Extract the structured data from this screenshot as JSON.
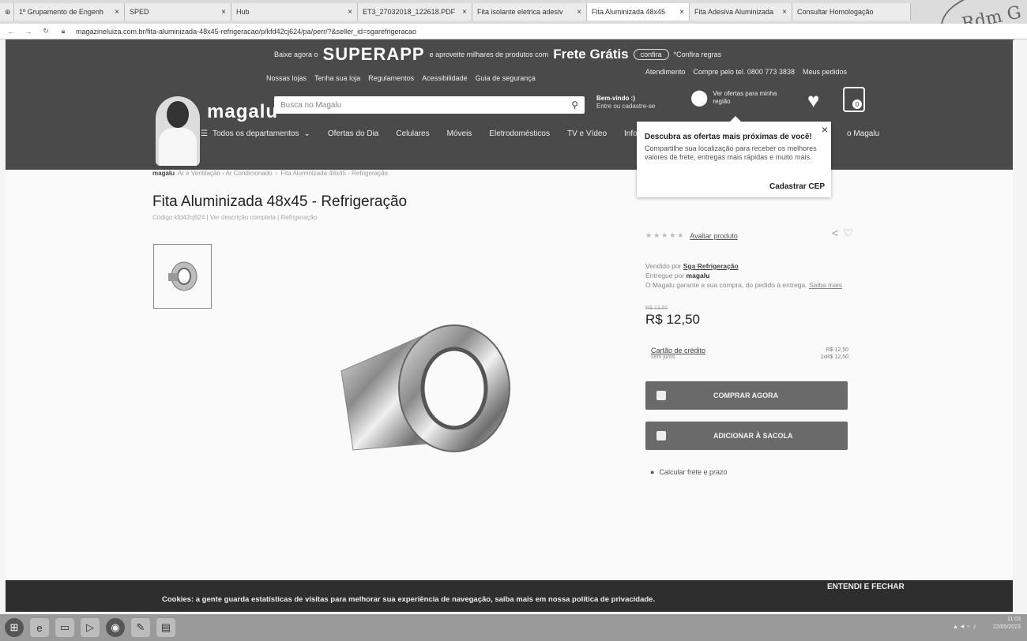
{
  "browser": {
    "tabs": [
      {
        "label": "1º Grupamento de Engenh"
      },
      {
        "label": "SPED"
      },
      {
        "label": "Hub"
      },
      {
        "label": "ET3_27032018_122618.PDF"
      },
      {
        "label": "Fita isolante eletrica adesiv"
      },
      {
        "label": "Fita Aluminizada 48x45"
      },
      {
        "label": "Fita Adesiva Aluminizada"
      },
      {
        "label": "Consultar Homologação"
      }
    ],
    "url": "magazineluiza.com.br/fita-aluminizada-48x45-refrigeracao/p/kfd42cj624/pa/perr/?&seller_id=sgarefrigeracao"
  },
  "stamp": {
    "text": "Rdm G"
  },
  "header": {
    "promo": {
      "download": "Baixe agora o",
      "app": "SUPERAPP",
      "enjoy": "e aproveite milhares de produtos com",
      "free": "Frete Grátis",
      "confira": "confira",
      "rules": "*Confira regras"
    },
    "links_left": [
      "Nossas lojas",
      "Tenha sua loja",
      "Regulamentos",
      "Acessibilidade",
      "Guia de segurança"
    ],
    "links_right": [
      "Atendimento",
      "Compre pelo tel. 0800 773 3838",
      "Meus pedidos"
    ],
    "logo": "magalu",
    "search_placeholder": "Busca no Magalu",
    "welcome_line1": "Bem-vindo :)",
    "welcome_line2": "Entre ou cadastre-se",
    "location_text": "Ver ofertas para minha região",
    "bag_count": "0",
    "menu": [
      "Todos os departamentos",
      "Ofertas do Dia",
      "Celulares",
      "Móveis",
      "Eletrodomésticos",
      "TV e Vídeo",
      "Info"
    ],
    "menu_right": "o Magalu"
  },
  "popup": {
    "title": "Descubra as ofertas mais próximas de você!",
    "text": "Compartilhe sua localização para receber os melhores valores de frete, entregas mais rápidas e muito mais.",
    "cta": "Cadastrar CEP"
  },
  "product": {
    "breadcrumb_home": "magalu",
    "breadcrumb_mid": "Ar e Ventilação › Ar Condicionado",
    "breadcrumb_current": "Fita Aluminizada 48x45 - Refrigeração",
    "title": "Fita Aluminizada 48x45 - Refrigeração",
    "code": "Código kfd42cj624 | Ver descrição completa | Refrigeração",
    "rating_link": "Avaliar produto",
    "sold_by_label": "Vendido por",
    "sold_by": "Sga Refrigeração",
    "delivered_by_label": "Entregue por",
    "delivered_by": "magalu",
    "guarantee": "O Magalu garante a sua compra, do pedido à entrega.",
    "guarantee_link": "Saiba mais",
    "old_price": "R$ 13,50",
    "price": "R$ 12,50",
    "payment_method": "Cartão de crédito",
    "payment_sub": "sem juros",
    "payment_total": "R$ 12,50",
    "payment_install": "1xR$ 12,50",
    "buy_label": "COMPRAR AGORA",
    "addbag_label": "ADICIONAR À SACOLA",
    "freight_label": "Calcular frete e prazo"
  },
  "cookie": {
    "message": "Cookies: a gente guarda estatísticas de visitas para melhorar sua experiência de navegação, saiba mais em nossa política de privacidade.",
    "button": "ENTENDI E FECHAR"
  },
  "taskbar": {
    "time": "11:03",
    "date": "22/05/2023"
  }
}
